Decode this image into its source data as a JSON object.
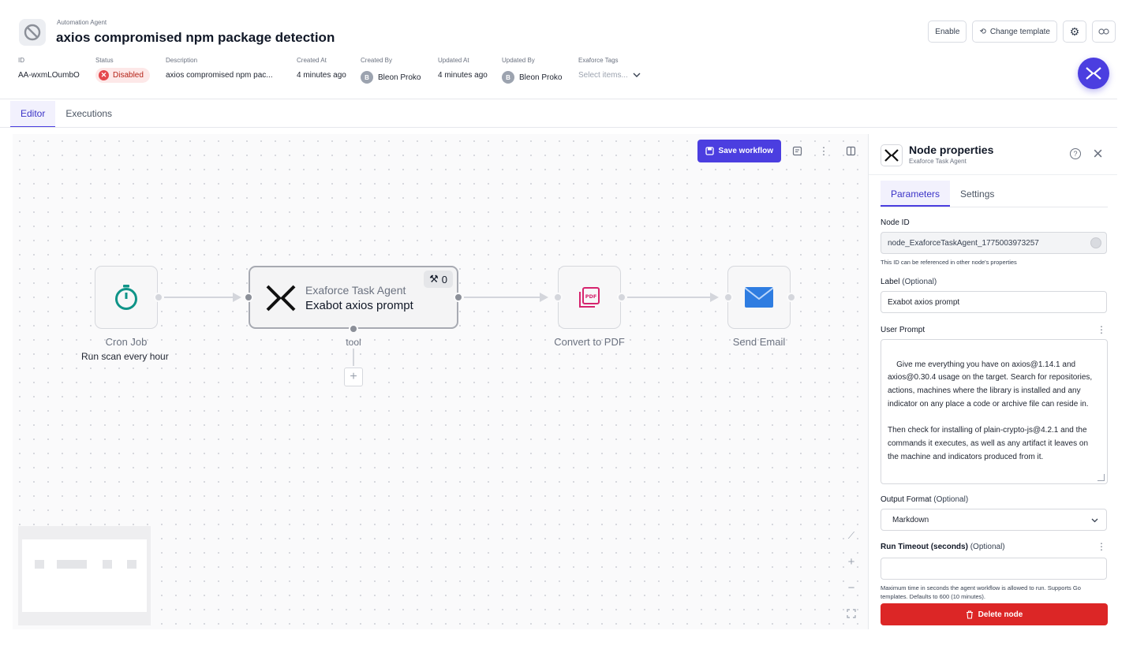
{
  "header": {
    "kind": "Automation Agent",
    "title": "axios compromised npm package detection",
    "actions": {
      "enable": "Enable",
      "change_template": "Change template"
    }
  },
  "meta": {
    "id": {
      "label": "ID",
      "value": "AA-wxmLOumbO"
    },
    "status": {
      "label": "Status",
      "value": "Disabled"
    },
    "description": {
      "label": "Description",
      "value": "axios compromised npm pac..."
    },
    "created_at": {
      "label": "Created At",
      "value": "4 minutes ago"
    },
    "created_by": {
      "label": "Created By",
      "initial": "B",
      "value": "Bleon Proko"
    },
    "updated_at": {
      "label": "Updated At",
      "value": "4 minutes ago"
    },
    "updated_by": {
      "label": "Updated By",
      "initial": "B",
      "value": "Bleon Proko"
    },
    "tags": {
      "label": "Exaforce Tags",
      "placeholder": "Select items..."
    }
  },
  "tabs": [
    "Editor",
    "Executions"
  ],
  "canvas": {
    "save_label": "Save workflow",
    "nodes": {
      "cron": {
        "label": "Cron Job",
        "sub": "Run scan every hour"
      },
      "agent": {
        "kind": "Exaforce Task Agent",
        "name": "Exabot axios prompt",
        "tool_count": "0",
        "tool_label": "tool"
      },
      "pdf": {
        "label": "Convert to PDF",
        "icon_text": "PDF"
      },
      "email": {
        "label": "Send Email"
      }
    }
  },
  "panel": {
    "title": "Node properties",
    "subtitle": "Exaforce Task Agent",
    "tabs": [
      "Parameters",
      "Settings"
    ],
    "node_id": {
      "label": "Node ID",
      "value": "node_ExaforceTaskAgent_1775003973257",
      "help": "This ID can be referenced in other node's properties"
    },
    "label_field": {
      "label": "Label",
      "optional": "(Optional)",
      "value": "Exabot axios prompt"
    },
    "user_prompt": {
      "label": "User Prompt",
      "value": "Give me everything you have on axios@1.14.1 and axios@0.30.4 usage on the target. Search for repositories, actions, machines where the library is installed and any indicator on any place a code or archive file can reside in.\n\nThen check for installing of plain-crypto-js@4.2.1 and the commands it executes, as well as any artifact it leaves on the machine and indicators produced from it."
    },
    "output_format": {
      "label": "Output Format",
      "optional": "(Optional)",
      "value": "Markdown"
    },
    "run_timeout": {
      "label": "Run Timeout (seconds)",
      "optional": "(Optional)",
      "value": "",
      "help": "Maximum time in seconds the agent workflow is allowed to run. Supports Go templates. Defaults to 600 (10 minutes)."
    },
    "delete_label": "Delete node"
  },
  "colors": {
    "accent": "#4b3ee0",
    "danger": "#dc2626",
    "pdf": "#d6246e",
    "timer": "#0f9488",
    "mail": "#2f7de1"
  }
}
